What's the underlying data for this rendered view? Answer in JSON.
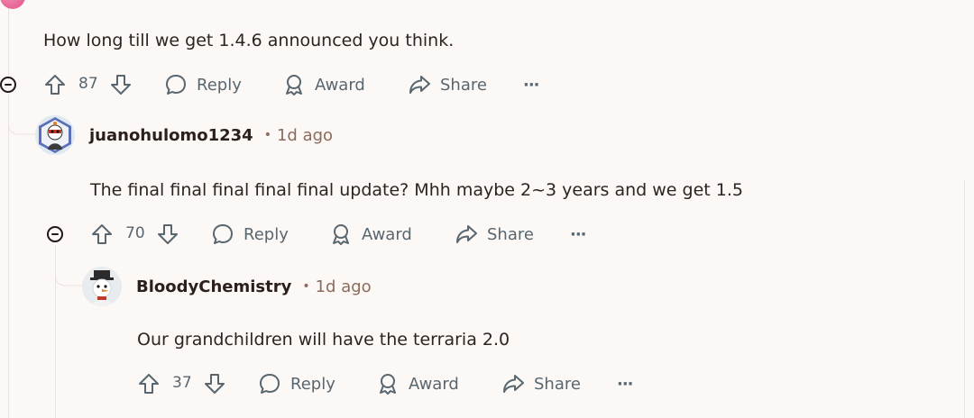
{
  "comments": [
    {
      "text": "How long till we get 1.4.6 announced you think.",
      "votes": "87",
      "reply_label": "Reply",
      "award_label": "Award",
      "share_label": "Share",
      "more_label": "···"
    },
    {
      "username": "juanohulomo1234",
      "time": "1d ago",
      "dot": "•",
      "text": "The final final final final final update? Mhh maybe 2~3 years and we get 1.5",
      "votes": "70",
      "reply_label": "Reply",
      "award_label": "Award",
      "share_label": "Share",
      "more_label": "···"
    },
    {
      "username": "BloodyChemistry",
      "time": "1d ago",
      "dot": "•",
      "text": "Our grandchildren will have the terraria 2.0",
      "votes": "37",
      "reply_label": "Reply",
      "award_label": "Award",
      "share_label": "Share",
      "more_label": "···"
    }
  ],
  "colors": {
    "background": "#fcf8f6",
    "action_text": "#586670",
    "timestamp": "#8a6b5c",
    "username": "#2a1f1a"
  }
}
